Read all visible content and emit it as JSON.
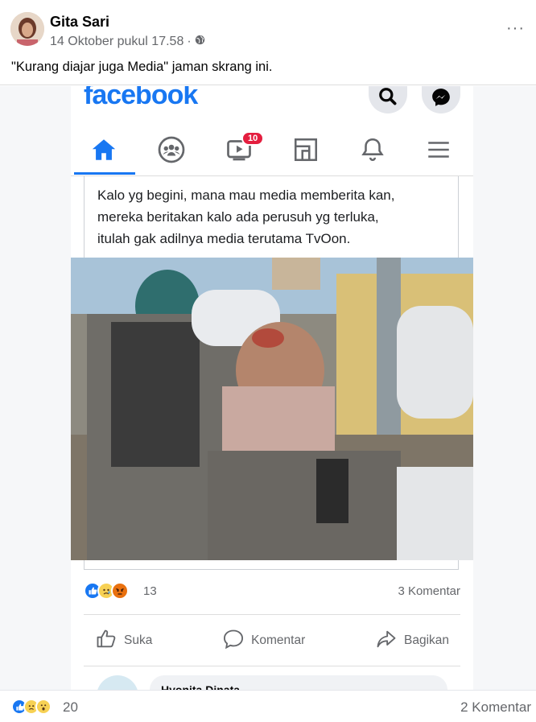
{
  "post": {
    "author": "Gita Sari",
    "timestamp": "14 Oktober pukul 17.58",
    "separator": "·",
    "privacy_icon": "globe-icon",
    "caption": "\"Kurang diajar juga Media\" jaman skrang ini.",
    "more_icon": "more-options-icon",
    "more_label": "···"
  },
  "screenshot": {
    "logo_text": "facebook",
    "nav": {
      "items": [
        "home-icon",
        "groups-icon",
        "watch-icon",
        "marketplace-icon",
        "notifications-icon",
        "menu-icon"
      ],
      "watch_badge": "10",
      "active": "home-icon"
    },
    "shared_text": [
      "Kalo yg begini, mana mau media memberita kan,",
      "mereka beritakan kalo ada perusuh yg terluka,",
      "itulah gak adilnya media terutama TvOon."
    ],
    "reactions": {
      "icons": [
        "like",
        "sad",
        "angry"
      ],
      "count": "13",
      "comments": "3 Komentar"
    },
    "actions": {
      "like": "Suka",
      "comment": "Komentar",
      "share": "Bagikan"
    },
    "comment_preview_name": "Hyonita Dinata"
  },
  "footer": {
    "reactions": [
      "like",
      "sad",
      "wow"
    ],
    "count": "20",
    "comments": "2 Komentar"
  },
  "colors": {
    "brand": "#1877f2",
    "badge": "#e41e3f",
    "muted": "#65676b"
  }
}
